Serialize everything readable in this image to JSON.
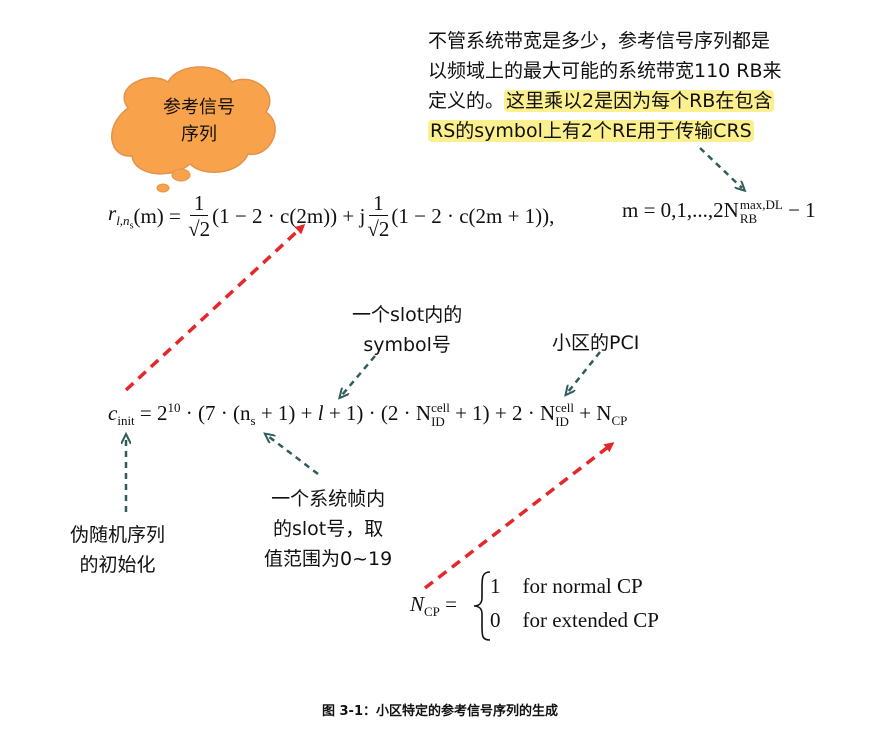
{
  "note": {
    "line1": "不管系统带宽是多少，参考信号序列都是",
    "line2": "以频域上的最大可能的系统带宽110 RB来",
    "line3_plain": "定义的。",
    "line3_highlight": "这里乘以2是因为每个RB在包含",
    "line4_highlight": "RS的symbol上有2个RE用于传输CRS"
  },
  "bubble": {
    "line1": "参考信号",
    "line2": "序列"
  },
  "eq_r": {
    "lhs": "r",
    "lhs_sub": "l,n",
    "lhs_subsub": "s",
    "arg": "(m) = ",
    "frac_num": "1",
    "frac_den": "√2",
    "term1": "(1 − 2 · c(2m)) + j",
    "term2": "(1 − 2 · c(2m + 1)),",
    "range": "m = 0,1,...,2N",
    "range_sup": "max,DL",
    "range_sub": "RB",
    "range_tail": " − 1"
  },
  "eq_c": {
    "lhs": "c",
    "lhs_sub": "init",
    "eq": " = 2",
    "pow": "10",
    "p1": " · (7 · (n",
    "ns_sub": "s",
    "p2": " + 1) + ",
    "l": "l",
    "p3": " + 1) · (2 · N",
    "n1_sup": "cell",
    "n1_sub": "ID",
    "p4": " + 1) + 2 · N",
    "n2_sup": "cell",
    "n2_sub": "ID",
    "p5": " + N",
    "ncp_sub": "CP"
  },
  "eq_ncp": {
    "lhs": "N",
    "lhs_sub": "CP",
    "eq": "=",
    "case1_val": "1",
    "case1_text": "for normal CP",
    "case2_val": "0",
    "case2_text": "for extended CP"
  },
  "labels": {
    "slot_symbol_l1": "一个slot内的",
    "slot_symbol_l2": "symbol号",
    "pci": "小区的PCI",
    "slot_no_l1": "一个系统帧内",
    "slot_no_l2": "的slot号，取",
    "slot_no_l3": "值范围为0~19",
    "prs_l1": "伪随机序列",
    "prs_l2": "的初始化"
  },
  "caption": "图 3-1：小区特定的参考信号序列的生成",
  "colors": {
    "red_arrow": "#e5262a",
    "teal_arrow": "#2f5d5c",
    "bubble_fill": "#f9a24c",
    "highlight": "#fbef8e"
  }
}
